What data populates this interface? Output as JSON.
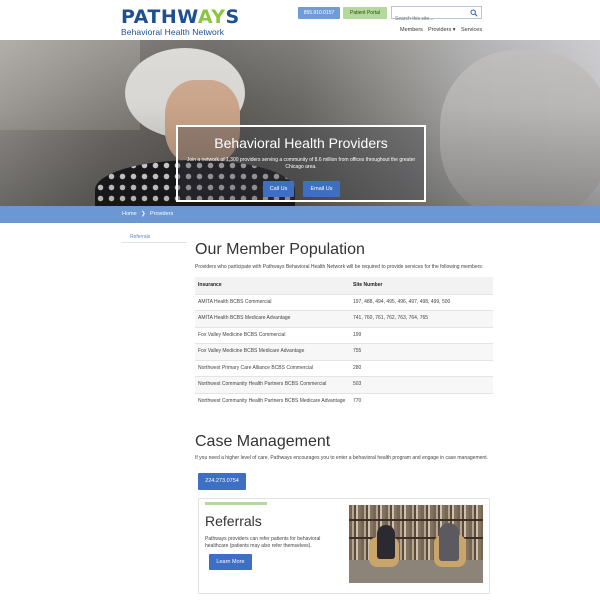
{
  "header": {
    "logo_main_a": "PATHW",
    "logo_main_accent": "AY",
    "logo_main_b": "S",
    "logo_sub": "Behavioral Health Network",
    "phone_label": "855.910.0157",
    "portal_label": "Patient Portal",
    "search_placeholder": "Search this site...",
    "nav": {
      "members": "Members",
      "providers": "Providers ▾",
      "services": "Services"
    }
  },
  "hero": {
    "title": "Behavioral Health Providers",
    "subtitle": "Join a network of 1,300 providers serving a community of 8.6 million from offices throughout the greater Chicago area.",
    "call_label": "Call Us",
    "email_label": "Email Us"
  },
  "breadcrumb": {
    "home": "Home",
    "separator": "❯",
    "current": "Providers"
  },
  "sidebar": {
    "referrals": "Referrals"
  },
  "member_population": {
    "title": "Our Member Population",
    "intro": "Providers who participate with Pathways Behavioral Health Network will be required to provide services for the following members:",
    "columns": [
      "Insurance",
      "Site Number"
    ],
    "rows": [
      {
        "insurance": "AMITA Health BCBS Commercial",
        "site": "197, 488, 494, 495, 496, 497, 498, 499, 500"
      },
      {
        "insurance": "AMITA Health BCBS Medicare Advantage",
        "site": "741, 760, 761, 762, 763, 764, 765"
      },
      {
        "insurance": "Fox Valley Medicine BCBS Commercial",
        "site": "199"
      },
      {
        "insurance": "Fox Valley Medicine BCBS Medicare Advantage",
        "site": "755"
      },
      {
        "insurance": "Northwest Primary Care Alliance BCBS Commercial",
        "site": "280"
      },
      {
        "insurance": "Northwest Community Health Partners BCBS Commercial",
        "site": "503"
      },
      {
        "insurance": "Northwest Community Health Partners BCBS Medicare Advantage",
        "site": "770"
      }
    ]
  },
  "case_management": {
    "title": "Case Management",
    "text": "If you need a higher level of care, Pathways encourages you to enter a behavioral health program and engage in case management.",
    "phone_label": "224.273.0754"
  },
  "referrals_card": {
    "title": "Referrals",
    "text": "Pathways providers can refer patients for behavioral healthcare (patients may also refer themselves).",
    "button_label": "Learn More"
  },
  "colors": {
    "primary_blue": "#3d6fc4",
    "crumb_blue": "#6b98d3",
    "accent_green": "#b5d99a",
    "logo_blue": "#1d4f91"
  }
}
